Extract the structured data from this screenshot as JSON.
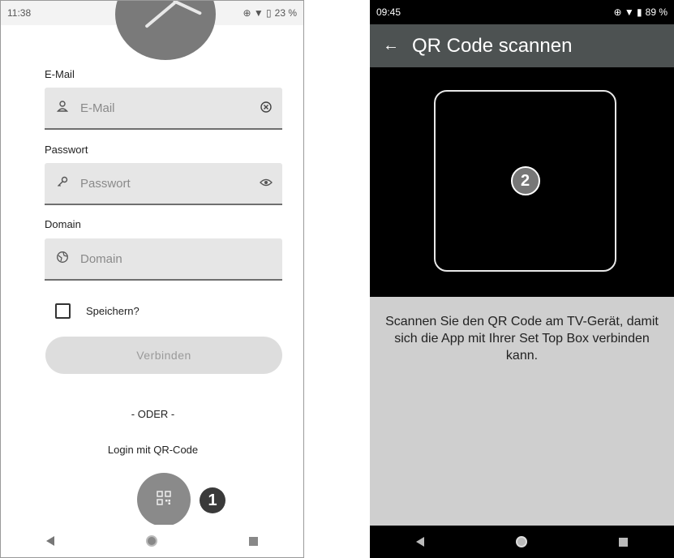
{
  "left_screen": {
    "status_bar": {
      "time": "11:38",
      "icons_text": "⊕ ▼ ▯",
      "battery": "23 %"
    },
    "email": {
      "label": "E-Mail",
      "placeholder": "E-Mail"
    },
    "password": {
      "label": "Passwort",
      "placeholder": "Passwort"
    },
    "domain": {
      "label": "Domain",
      "placeholder": "Domain"
    },
    "remember": {
      "label": "Speichern?",
      "checked": false
    },
    "connect_button": "Verbinden",
    "separator": "- ODER -",
    "qr_login_label": "Login mit QR-Code",
    "callout_number": "1"
  },
  "right_screen": {
    "status_bar": {
      "time": "09:45",
      "icons_text": "⊕ ▼ ▮",
      "battery": "89 %"
    },
    "app_bar": {
      "title": "QR Code scannen"
    },
    "callout_number": "2",
    "instruction": "Scannen Sie den QR Code am TV-Gerät, damit sich die App mit Ihrer Set Top Box verbinden kann."
  },
  "colors": {
    "app_bar": "#4d5252",
    "instruction_bg": "#cfcfcf",
    "fab": "#8a8a8a"
  }
}
